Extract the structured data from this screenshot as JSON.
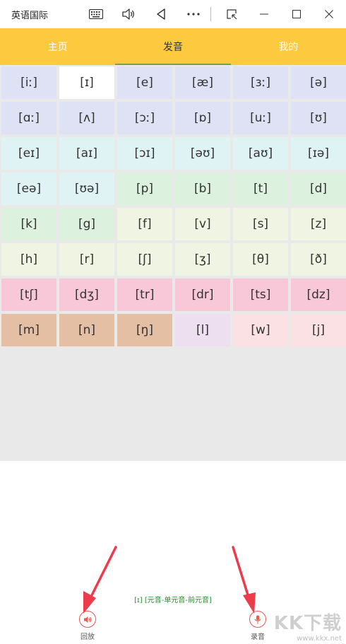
{
  "window": {
    "title": "英语国际"
  },
  "tabs": [
    {
      "label": "主页",
      "active": false
    },
    {
      "label": "发音",
      "active": true
    },
    {
      "label": "我的",
      "active": false
    }
  ],
  "colors": {
    "tab_bar": "#fdc93f",
    "lavender": "#dfe1f4",
    "aqua": "#dff3f4",
    "mint": "#dcf1de",
    "cream": "#eff4e3",
    "pink": "#f8c8d8",
    "peach": "#e5bfa3",
    "lilac": "#eedff0",
    "rose": "#fbe0e4",
    "selected": "#ffffff"
  },
  "phonemes": [
    {
      "symbol": "[iː]",
      "color": "lavender"
    },
    {
      "symbol": "[ɪ]",
      "color": "selected"
    },
    {
      "symbol": "[e]",
      "color": "lavender"
    },
    {
      "symbol": "[æ]",
      "color": "lavender"
    },
    {
      "symbol": "[ɜː]",
      "color": "lavender"
    },
    {
      "symbol": "[ə]",
      "color": "lavender"
    },
    {
      "symbol": "[ɑː]",
      "color": "lavender"
    },
    {
      "symbol": "[ʌ]",
      "color": "lavender"
    },
    {
      "symbol": "[ɔː]",
      "color": "lavender"
    },
    {
      "symbol": "[ɒ]",
      "color": "lavender"
    },
    {
      "symbol": "[uː]",
      "color": "lavender"
    },
    {
      "symbol": "[ʊ]",
      "color": "lavender"
    },
    {
      "symbol": "[eɪ]",
      "color": "aqua"
    },
    {
      "symbol": "[aɪ]",
      "color": "aqua"
    },
    {
      "symbol": "[ɔɪ]",
      "color": "aqua"
    },
    {
      "symbol": "[əʊ]",
      "color": "aqua"
    },
    {
      "symbol": "[aʊ]",
      "color": "aqua"
    },
    {
      "symbol": "[ɪə]",
      "color": "aqua"
    },
    {
      "symbol": "[eə]",
      "color": "aqua"
    },
    {
      "symbol": "[ʊə]",
      "color": "aqua"
    },
    {
      "symbol": "[p]",
      "color": "mint"
    },
    {
      "symbol": "[b]",
      "color": "mint"
    },
    {
      "symbol": "[t]",
      "color": "mint"
    },
    {
      "symbol": "[d]",
      "color": "mint"
    },
    {
      "symbol": "[k]",
      "color": "mint"
    },
    {
      "symbol": "[g]",
      "color": "mint"
    },
    {
      "symbol": "[f]",
      "color": "cream"
    },
    {
      "symbol": "[v]",
      "color": "cream"
    },
    {
      "symbol": "[s]",
      "color": "cream"
    },
    {
      "symbol": "[z]",
      "color": "cream"
    },
    {
      "symbol": "[h]",
      "color": "cream"
    },
    {
      "symbol": "[r]",
      "color": "cream"
    },
    {
      "symbol": "[ʃ]",
      "color": "cream"
    },
    {
      "symbol": "[ʒ]",
      "color": "cream"
    },
    {
      "symbol": "[θ]",
      "color": "cream"
    },
    {
      "symbol": "[ð]",
      "color": "cream"
    },
    {
      "symbol": "[tʃ]",
      "color": "pink"
    },
    {
      "symbol": "[dʒ]",
      "color": "pink"
    },
    {
      "symbol": "[tr]",
      "color": "pink"
    },
    {
      "symbol": "[dr]",
      "color": "pink"
    },
    {
      "symbol": "[ts]",
      "color": "pink"
    },
    {
      "symbol": "[dz]",
      "color": "pink"
    },
    {
      "symbol": "[m]",
      "color": "peach"
    },
    {
      "symbol": "[n]",
      "color": "peach"
    },
    {
      "symbol": "[ŋ]",
      "color": "peach"
    },
    {
      "symbol": "[l]",
      "color": "lilac"
    },
    {
      "symbol": "[w]",
      "color": "rose"
    },
    {
      "symbol": "[j]",
      "color": "rose"
    }
  ],
  "selected_info": "[ɪ] [元音-单元音-前元音]",
  "controls": {
    "playback_label": "回放",
    "record_label": "录音"
  },
  "watermark": {
    "brand": "KK下载",
    "url": "www.kkx.net"
  }
}
